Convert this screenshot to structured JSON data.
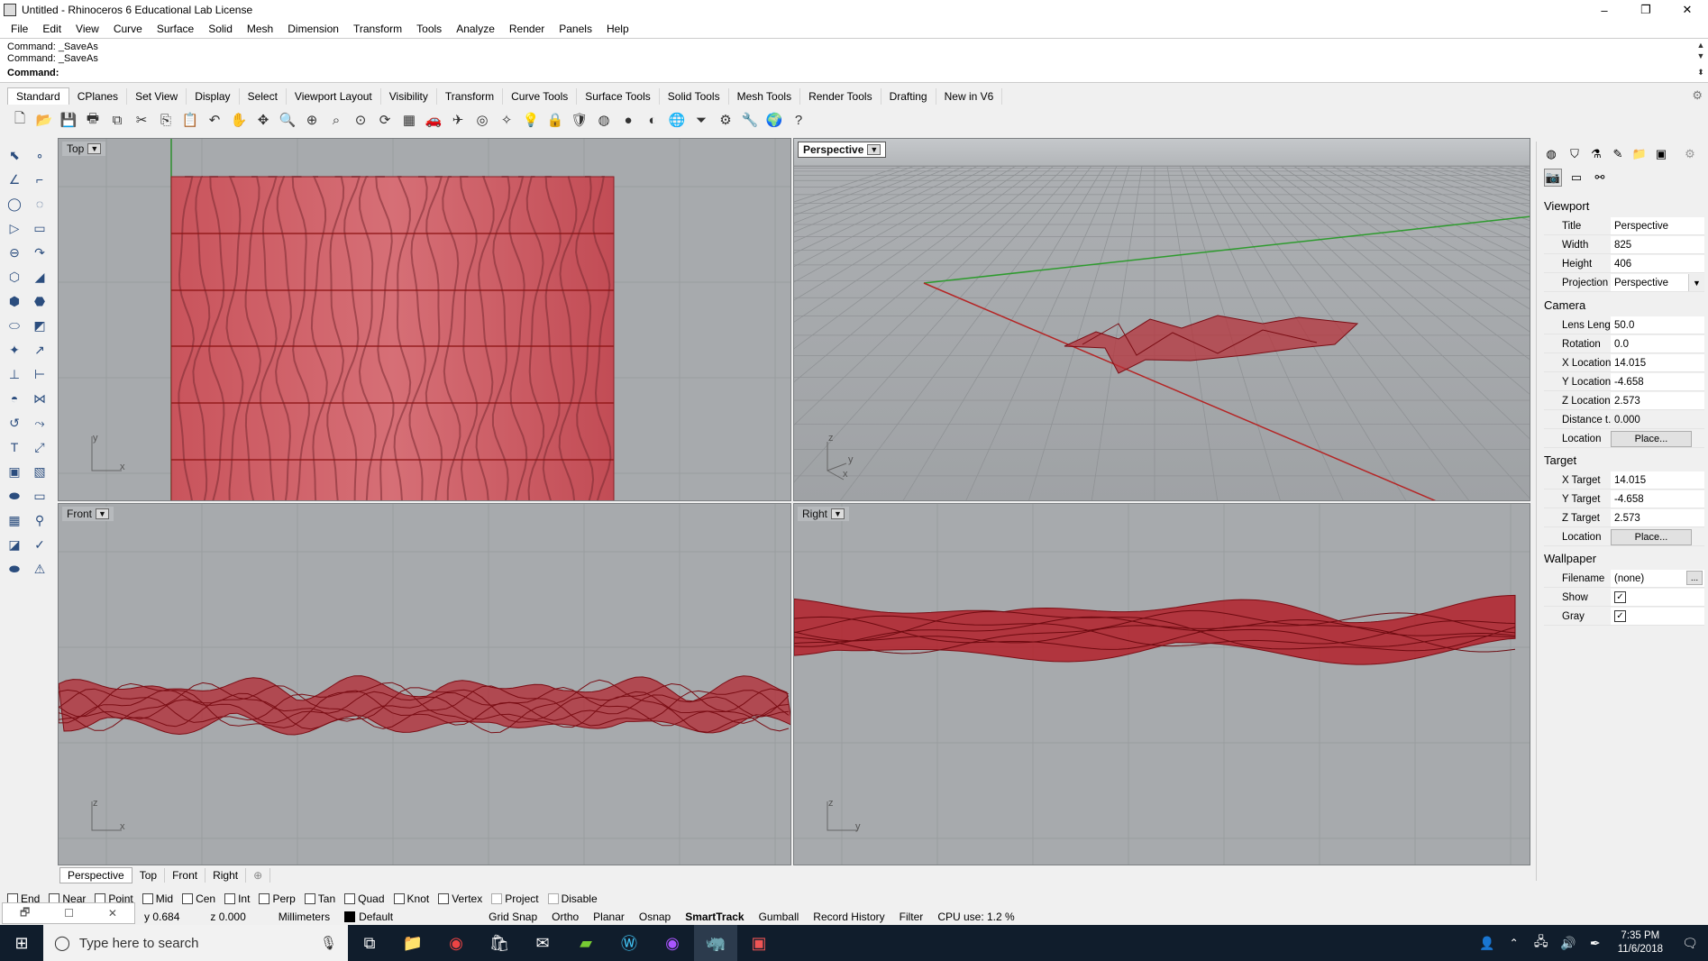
{
  "window": {
    "title": "Untitled - Rhinoceros 6 Educational Lab License",
    "minimize": "–",
    "maximize": "❐",
    "close": "✕"
  },
  "menu": [
    "File",
    "Edit",
    "View",
    "Curve",
    "Surface",
    "Solid",
    "Mesh",
    "Dimension",
    "Transform",
    "Tools",
    "Analyze",
    "Render",
    "Panels",
    "Help"
  ],
  "command": {
    "history": [
      "Command: _SaveAs",
      "Command: _SaveAs"
    ],
    "prompt": "Command:",
    "value": ""
  },
  "toolbar_tabs": [
    "Standard",
    "CPlanes",
    "Set View",
    "Display",
    "Select",
    "Viewport Layout",
    "Visibility",
    "Transform",
    "Curve Tools",
    "Surface Tools",
    "Solid Tools",
    "Mesh Tools",
    "Render Tools",
    "Drafting",
    "New in V6"
  ],
  "toolbar_icons": [
    "new-icon",
    "open-icon",
    "save-icon",
    "print-icon",
    "import-icon",
    "cut-icon",
    "copy-icon",
    "paste-icon",
    "undo-icon",
    "pan-icon",
    "move-view-icon",
    "zoom-icon",
    "zoom-window-icon",
    "zoom-extents-icon",
    "zoom-selected-icon",
    "rotate-view-icon",
    "four-views-icon",
    "car-icon",
    "plane-icon",
    "cplane-icon",
    "lights-icon",
    "bulb-icon",
    "lock-icon",
    "shield-icon",
    "color-wheel-icon",
    "sphere-grey-icon",
    "sphere-shaded-icon",
    "sphere-blue-icon",
    "filter-icon",
    "gear-icon",
    "tools-icon",
    "globe-icon",
    "help-icon"
  ],
  "toolbar_glyphs": [
    "🗋",
    "📂",
    "💾",
    "🖶",
    "⧉",
    "✂",
    "⎘",
    "📋",
    "↶",
    "✋",
    "✥",
    "🔍",
    "⊕",
    "⌕",
    "⊙",
    "⟳",
    "▦",
    "🚗",
    "✈",
    "◎",
    "✧",
    "💡",
    "🔒",
    "🛡",
    "◍",
    "●",
    "◐",
    "🌐",
    "⏷",
    "⚙",
    "🔧",
    "🌍",
    "?"
  ],
  "left_tools": [
    "⬉",
    "∘",
    "∠",
    "⌐",
    "◯",
    "◌",
    "▷",
    "▭",
    "⊖",
    "↷",
    "⬡",
    "◢",
    "⬢",
    "⬣",
    "⬭",
    "◩",
    "✦",
    "↗",
    "⊥",
    "⊢",
    "◓",
    "⋈",
    "↺",
    "⤳",
    "T",
    "⤢",
    "▣",
    "▧",
    "⬬",
    "▭",
    "▦",
    "⚲",
    "◪",
    "✓",
    "⬬",
    "⚠"
  ],
  "viewports": {
    "top": {
      "label": "Top",
      "x": "x",
      "y": "y"
    },
    "perspective": {
      "label": "Perspective",
      "x": "x",
      "y": "y",
      "z": "z"
    },
    "front": {
      "label": "Front",
      "x": "x",
      "z": "z"
    },
    "right": {
      "label": "Right",
      "y": "y",
      "z": "z"
    }
  },
  "panel": {
    "viewport_section": "Viewport",
    "title_k": "Title",
    "title_v": "Perspective",
    "width_k": "Width",
    "width_v": "825",
    "height_k": "Height",
    "height_v": "406",
    "projection_k": "Projection",
    "projection_v": "Perspective",
    "camera_section": "Camera",
    "lens_k": "Lens Length",
    "lens_v": "50.0",
    "rotation_k": "Rotation",
    "rotation_v": "0.0",
    "xloc_k": "X Location",
    "xloc_v": "14.015",
    "yloc_k": "Y Location",
    "yloc_v": "-4.658",
    "zloc_k": "Z Location",
    "zloc_v": "2.573",
    "dist_k": "Distance t...",
    "dist_v": "0.000",
    "loc_k": "Location",
    "place": "Place...",
    "target_section": "Target",
    "xt_k": "X Target",
    "xt_v": "14.015",
    "yt_k": "Y Target",
    "yt_v": "-4.658",
    "zt_k": "Z Target",
    "zt_v": "2.573",
    "tloc_k": "Location",
    "wallpaper_section": "Wallpaper",
    "filename_k": "Filename",
    "filename_v": "(none)",
    "ellipsis": "...",
    "show_k": "Show",
    "gray_k": "Gray",
    "check": "✓"
  },
  "viewport_tabs": [
    "Perspective",
    "Top",
    "Front",
    "Right"
  ],
  "add_tab": "⊕",
  "osnaps": [
    "End",
    "Near",
    "Point",
    "Mid",
    "Cen",
    "Int",
    "Perp",
    "Tan",
    "Quad",
    "Knot",
    "Vertex",
    "Project",
    "Disable"
  ],
  "status": {
    "y": "y 0.684",
    "z": "z 0.000",
    "units": "Millimeters",
    "layer": "Default",
    "grid_snap": "Grid Snap",
    "ortho": "Ortho",
    "planar": "Planar",
    "osnap": "Osnap",
    "smarttrack": "SmartTrack",
    "gumball": "Gumball",
    "record_history": "Record History",
    "filter": "Filter",
    "cpu": "CPU use: 1.2 %"
  },
  "float_icons": [
    "🗗",
    "☐",
    "✕"
  ],
  "taskbar": {
    "search_placeholder": "Type here to search",
    "time": "7:35 PM",
    "date": "11/6/2018"
  },
  "colors": {
    "surface_red": "#c8313b",
    "viewport_bg": "#a7aaad",
    "x_axis": "#b52525",
    "y_axis": "#2e9b2e"
  }
}
